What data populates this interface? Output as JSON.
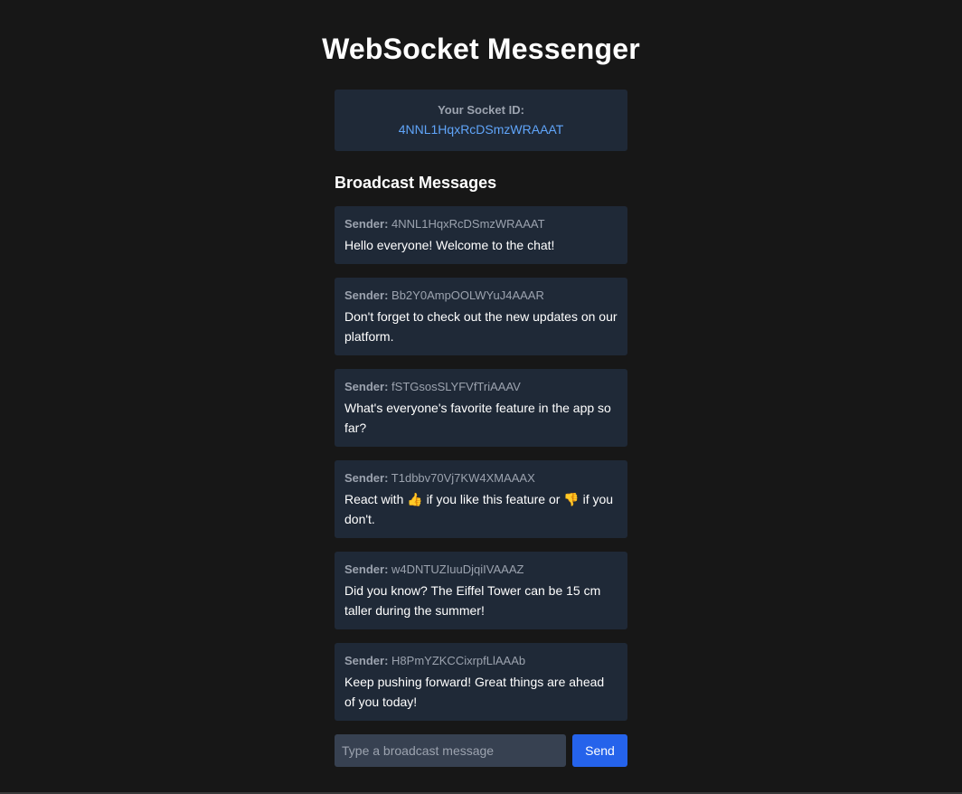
{
  "app": {
    "title": "WebSocket Messenger"
  },
  "socket": {
    "label": "Your Socket ID:",
    "id": "4NNL1HqxRcDSmzWRAAAT"
  },
  "broadcast": {
    "heading": "Broadcast Messages",
    "sender_label": "Sender:",
    "messages": [
      {
        "sender": "4NNL1HqxRcDSmzWRAAAT",
        "text": "Hello everyone! Welcome to the chat!"
      },
      {
        "sender": "Bb2Y0AmpOOLWYuJ4AAAR",
        "text": "Don't forget to check out the new updates on our platform."
      },
      {
        "sender": "fSTGsosSLYFVfTriAAAV",
        "text": "What's everyone's favorite feature in the app so far?"
      },
      {
        "sender": "T1dbbv70Vj7KW4XMAAAX",
        "text": "React with 👍 if you like this feature or 👎 if you don't."
      },
      {
        "sender": "w4DNTUZIuuDjqiIVAAAZ",
        "text": "Did you know? The Eiffel Tower can be 15 cm taller during the summer!"
      },
      {
        "sender": "H8PmYZKCCixrpfLlAAAb",
        "text": "Keep pushing forward! Great things are ahead of you today!"
      }
    ]
  },
  "composer": {
    "placeholder": "Type a broadcast message",
    "value": "",
    "send_label": "Send"
  },
  "colors": {
    "background": "#171717",
    "card": "#1f2937",
    "accent": "#2563eb",
    "socket_id": "#60a5fa",
    "muted": "#9ca3af",
    "input": "#374151"
  }
}
